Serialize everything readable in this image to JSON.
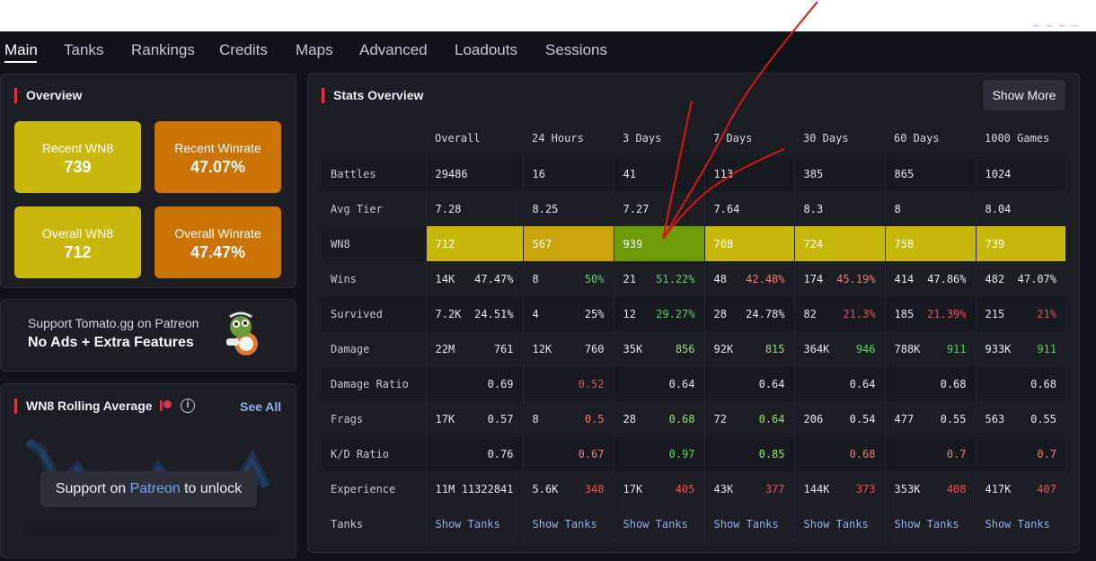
{
  "nav": {
    "tabs": [
      "Main",
      "Tanks",
      "Rankings",
      "Credits",
      "Maps",
      "Advanced",
      "Loadouts",
      "Sessions"
    ],
    "active": "Main"
  },
  "overview": {
    "title": "Overview",
    "recent_wn8_label": "Recent WN8",
    "recent_wn8_value": "739",
    "recent_winrate_label": "Recent Winrate",
    "recent_winrate_value": "47.07%",
    "overall_wn8_label": "Overall WN8",
    "overall_wn8_value": "712",
    "overall_winrate_label": "Overall Winrate",
    "overall_winrate_value": "47.47%"
  },
  "patreon": {
    "line1": "Support Tomato.gg on Patreon",
    "line2": "No Ads + Extra Features"
  },
  "rolling": {
    "title": "WN8 Rolling Average",
    "see_all": "See All",
    "info": "i",
    "unlock_pre": "Support on ",
    "unlock_link": "Patreon",
    "unlock_post": " to unlock"
  },
  "stats": {
    "title": "Stats Overview",
    "show_more": "Show More",
    "columns": [
      "Overall",
      "24 Hours",
      "3 Days",
      "7 Days",
      "30 Days",
      "60 Days",
      "1000 Games"
    ],
    "battles_label": "Battles",
    "battles": [
      "29486",
      "16",
      "41",
      "113",
      "385",
      "865",
      "1024"
    ],
    "avg_tier_label": "Avg Tier",
    "avg_tier": [
      "7.28",
      "8.25",
      "7.27",
      "7.64",
      "8.3",
      "8",
      "8.04"
    ],
    "wn8_label": "WN8",
    "wn8": [
      "712",
      "567",
      "939",
      "708",
      "724",
      "758",
      "739"
    ],
    "wins_label": "Wins",
    "wins_count": [
      "14K",
      "8",
      "21",
      "48",
      "174",
      "414",
      "482"
    ],
    "wins_pct": [
      "47.47%",
      "50%",
      "51.22%",
      "42.48%",
      "45.19%",
      "47.86%",
      "47.07%"
    ],
    "survived_label": "Survived",
    "survived_count": [
      "7.2K",
      "4",
      "12",
      "28",
      "82",
      "185",
      "215"
    ],
    "survived_pct": [
      "24.51%",
      "25%",
      "29.27%",
      "24.78%",
      "21.3%",
      "21.39%",
      "21%"
    ],
    "damage_label": "Damage",
    "damage_total": [
      "22M",
      "12K",
      "35K",
      "92K",
      "364K",
      "788K",
      "933K"
    ],
    "damage_avg": [
      "761",
      "760",
      "856",
      "815",
      "946",
      "911",
      "911"
    ],
    "damage_ratio_label": "Damage Ratio",
    "damage_ratio": [
      "0.69",
      "0.52",
      "0.64",
      "0.64",
      "0.64",
      "0.68",
      "0.68"
    ],
    "frags_label": "Frags",
    "frags_total": [
      "17K",
      "8",
      "28",
      "72",
      "206",
      "477",
      "563"
    ],
    "frags_avg": [
      "0.57",
      "0.5",
      "0.68",
      "0.64",
      "0.54",
      "0.55",
      "0.55"
    ],
    "kd_label": "K/D Ratio",
    "kd": [
      "0.76",
      "0.67",
      "0.97",
      "0.85",
      "0.68",
      "0.7",
      "0.7"
    ],
    "experience_label": "Experience",
    "exp_total": [
      "11M",
      "5.6K",
      "17K",
      "43K",
      "144K",
      "353K",
      "417K"
    ],
    "exp_avg": [
      "11322841",
      "348",
      "405",
      "377",
      "373",
      "408",
      "407"
    ],
    "tanks_label": "Tanks",
    "show_tanks": "Show Tanks",
    "wn8_colors": [
      "#c9b80c",
      "#c9a30a",
      "#6f9a08",
      "#c9b80c",
      "#c9b80c",
      "#c9b80c",
      "#c9b80c"
    ]
  },
  "colors": {
    "accent": "#e0344a",
    "good": "#58d368",
    "bad": "#ee4f56",
    "link": "#8fb1f0"
  }
}
